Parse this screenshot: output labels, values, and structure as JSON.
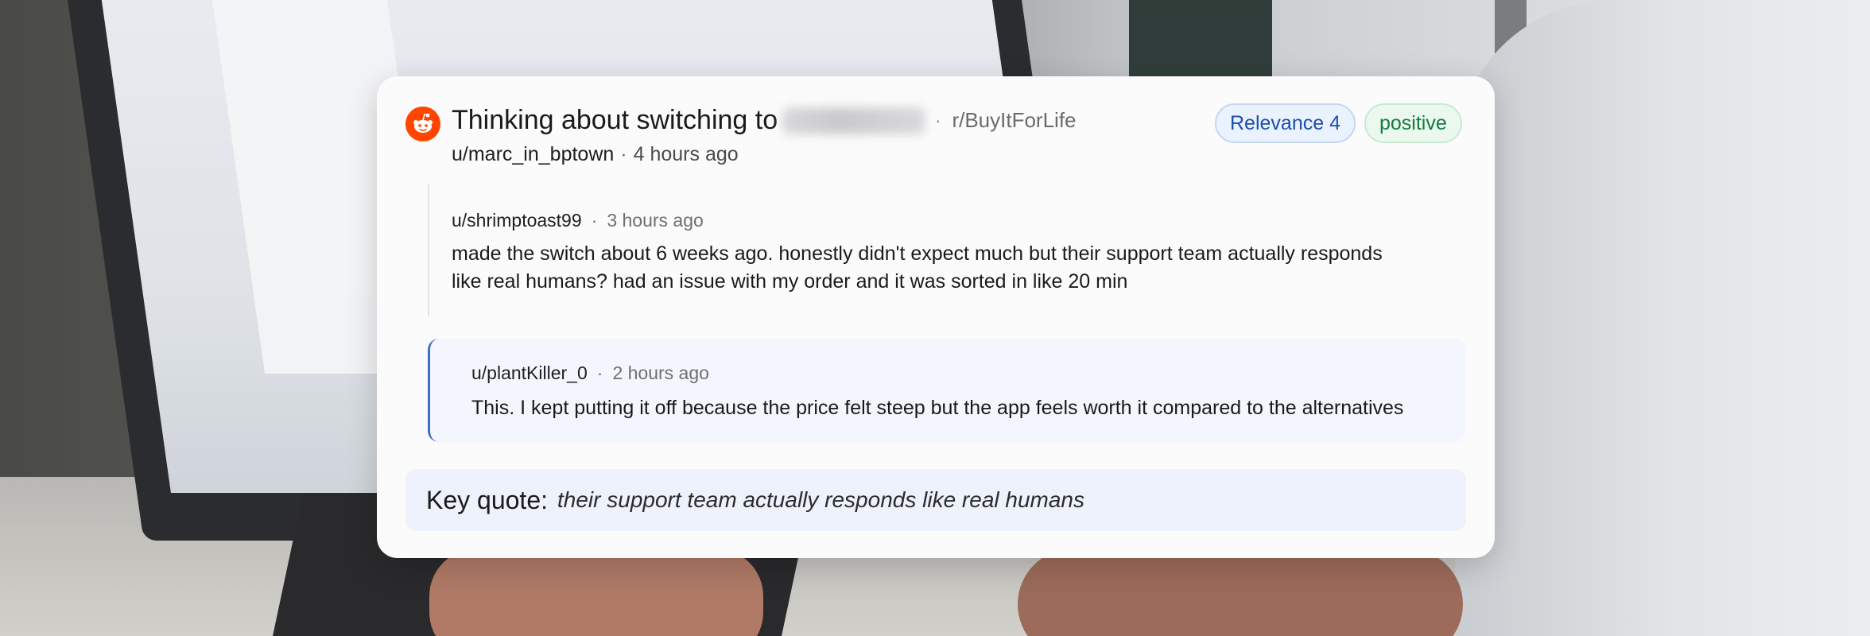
{
  "post": {
    "title": "Thinking about switching to",
    "brand_redacted": "Brandname",
    "separator": "·",
    "subreddit": "r/BuyItForLife",
    "author": "u/marc_in_bptown",
    "time": "4 hours ago",
    "platform_icon": "reddit-icon",
    "platform_color": "#ff4500"
  },
  "badges": {
    "relevance": "Relevance 4",
    "sentiment": "positive"
  },
  "comments": [
    {
      "author": "u/shrimptoast99",
      "time": "3 hours ago",
      "line1": "made the switch about 6 weeks ago. honestly didn't expect much but their support team actually responds",
      "line2": "like real humans? had an issue with my order and it was sorted in like 20 min"
    },
    {
      "author": "u/plantKiller_0",
      "time": "2 hours ago",
      "text": "This. I kept putting it off because the price felt steep but the app feels worth it compared to the alternatives",
      "highlight_color": "#3e6fc7"
    }
  ],
  "key_quote": {
    "label": "Key quote:",
    "text": "their support team actually responds like real humans"
  }
}
